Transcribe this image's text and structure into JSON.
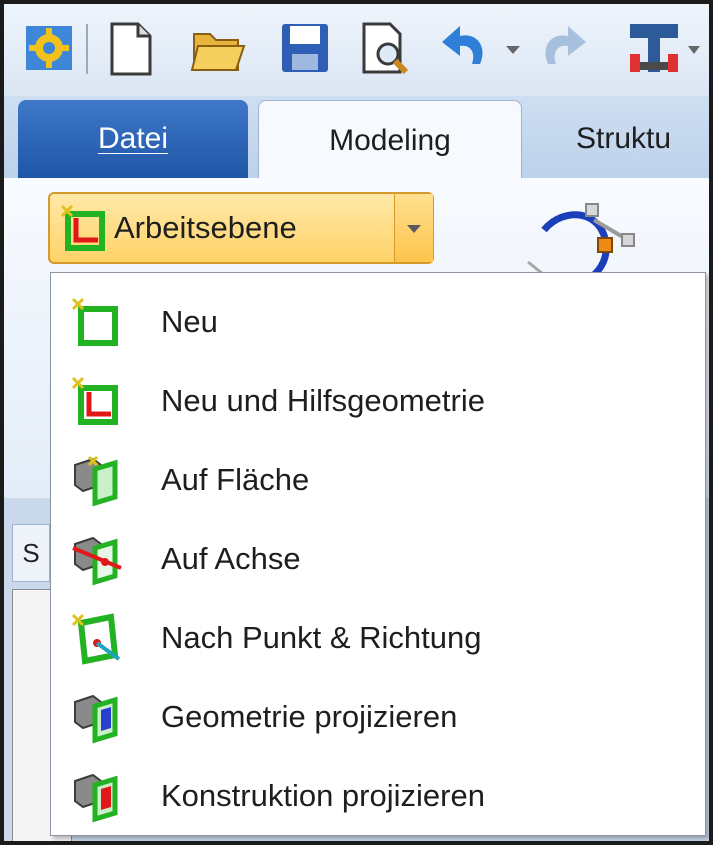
{
  "ribbon": {
    "tabs": [
      {
        "label": "Datei",
        "selected": false
      },
      {
        "label": "Modeling",
        "selected": true
      },
      {
        "label": "Struktu",
        "selected": false
      }
    ],
    "split_button": {
      "label": "Arbeitsebene",
      "icon": "workplane-new-icon",
      "dropdown_icon": "chevron-down-icon"
    }
  },
  "quick_access": {
    "icons": [
      "app-menu-icon",
      "new-document-icon",
      "open-folder-icon",
      "save-icon",
      "print-preview-icon",
      "undo-icon",
      "dropdown-arrow-icon",
      "redo-icon",
      "tools-icon"
    ]
  },
  "dropdown": {
    "items": [
      {
        "label": "Neu",
        "icon": "workplane-new-icon"
      },
      {
        "label": "Neu und Hilfsgeometrie",
        "icon": "workplane-helper-geometry-icon"
      },
      {
        "label": "Auf Fläche",
        "icon": "workplane-on-face-icon"
      },
      {
        "label": "Auf Achse",
        "icon": "workplane-on-axis-icon"
      },
      {
        "label": "Nach Punkt & Richtung",
        "icon": "workplane-point-direction-icon"
      },
      {
        "label": "Geometrie projizieren",
        "icon": "project-geometry-icon"
      },
      {
        "label": "Konstruktion projizieren",
        "icon": "project-construction-icon"
      }
    ]
  },
  "side_panel": {
    "tab_letter": "S"
  },
  "colors": {
    "menu_background": "#ffffff",
    "split_button_highlight": "#ffd267",
    "datei_tab": "#2a62b4",
    "icon_green": "#22b222",
    "icon_red": "#e01818"
  }
}
